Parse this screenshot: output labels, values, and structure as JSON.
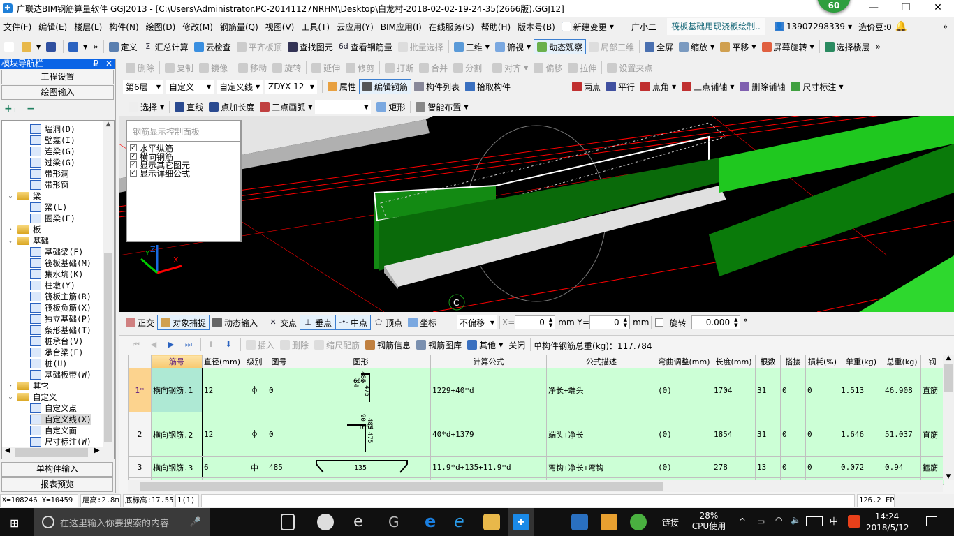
{
  "window": {
    "title": "广联达BIM钢筋算量软件 GGJ2013 - [C:\\Users\\Administrator.PC-20141127NRHM\\Desktop\\白龙村-2018-02-02-19-24-35(2666版).GGJ12]",
    "badge": "60",
    "minimize": "—",
    "restore": "❐",
    "close": "✕"
  },
  "menubar": {
    "items": [
      "文件(F)",
      "编辑(E)",
      "楼层(L)",
      "构件(N)",
      "绘图(D)",
      "修改(M)",
      "钢筋量(Q)",
      "视图(V)",
      "工具(T)",
      "云应用(Y)",
      "BIM应用(I)",
      "在线服务(S)",
      "帮助(H)",
      "版本号(B)"
    ],
    "new_change": "新建变更",
    "assistant": "广小二",
    "notice": "筏板基础用现浇板绘制..",
    "user": "13907298339",
    "beans": "造价豆:0",
    "more": "»"
  },
  "toolbar1": [
    {
      "label": "",
      "icon": "new-file",
      "c": "#fff"
    },
    {
      "label": "",
      "icon": "open-folder",
      "c": "#e8b84a",
      "dd": 1
    },
    {
      "label": "",
      "icon": "save",
      "c": "#3050a0"
    },
    {
      "sep": 1
    },
    {
      "label": "",
      "icon": "undo",
      "c": "#2a62c0",
      "dd": 1
    },
    {
      "label": "»",
      "icon": ""
    },
    {
      "sep": 1
    },
    {
      "label": "定义",
      "icon": "define",
      "c": "#5a7fb0"
    },
    {
      "label": "汇总计算",
      "icon": "sigma",
      "g": "Σ"
    },
    {
      "label": "云检查",
      "icon": "cloud-check",
      "c": "#3a8fe0"
    },
    {
      "label": "平齐板顶",
      "icon": "align-slab",
      "dis": 1,
      "c": "#ccc"
    },
    {
      "label": "查找图元",
      "icon": "binoculars",
      "c": "#335"
    },
    {
      "label": "查看钢筋量",
      "icon": "view-rebar",
      "g": "6d"
    },
    {
      "label": "批量选择",
      "icon": "batch-select",
      "dis": 1,
      "c": "#ddd"
    },
    {
      "sep": 1
    },
    {
      "label": "三维",
      "icon": "cube",
      "c": "#5a9ad8",
      "dd": 1
    },
    {
      "label": "俯视",
      "icon": "top-view",
      "c": "#7aa8e0",
      "dd": 1
    },
    {
      "label": "动态观察",
      "icon": "orbit",
      "c": "#6ab04c",
      "act": 1
    },
    {
      "label": "局部三维",
      "icon": "local-3d",
      "dis": 1,
      "c": "#ddd"
    },
    {
      "sep": 1
    },
    {
      "label": "全屏",
      "icon": "fullscreen",
      "c": "#4a70b0"
    },
    {
      "label": "缩放",
      "icon": "zoom",
      "c": "#7a9ac0",
      "dd": 1
    },
    {
      "label": "平移",
      "icon": "pan",
      "c": "#d0a050",
      "dd": 1
    },
    {
      "label": "屏幕旋转",
      "icon": "screen-rotate",
      "c": "#e06040",
      "dd": 1
    },
    {
      "sep": 1
    },
    {
      "label": "选择楼层",
      "icon": "select-floor",
      "c": "#2a8a60"
    },
    {
      "label": "»",
      "icon": ""
    }
  ],
  "toolbar2": [
    {
      "label": "删除",
      "icon": "delete",
      "dis": 1,
      "c": "#ccc"
    },
    {
      "sep": 1
    },
    {
      "label": "复制",
      "icon": "copy",
      "dis": 1,
      "c": "#ccc"
    },
    {
      "label": "镜像",
      "icon": "mirror",
      "dis": 1,
      "c": "#ccc"
    },
    {
      "sep": 1
    },
    {
      "label": "移动",
      "icon": "move",
      "dis": 1,
      "c": "#ccc"
    },
    {
      "label": "旋转",
      "icon": "rotate",
      "dis": 1,
      "c": "#ccc"
    },
    {
      "sep": 1
    },
    {
      "label": "延伸",
      "icon": "extend",
      "dis": 1,
      "c": "#ccc"
    },
    {
      "label": "修剪",
      "icon": "trim",
      "dis": 1,
      "c": "#ccc"
    },
    {
      "sep": 1
    },
    {
      "label": "打断",
      "icon": "break",
      "dis": 1,
      "c": "#ccc"
    },
    {
      "label": "合并",
      "icon": "merge",
      "dis": 1,
      "c": "#ccc"
    },
    {
      "label": "分割",
      "icon": "split",
      "dis": 1,
      "c": "#ccc"
    },
    {
      "sep": 1
    },
    {
      "label": "对齐",
      "icon": "align",
      "dis": 1,
      "c": "#ccc",
      "dd": 1
    },
    {
      "label": "偏移",
      "icon": "offset",
      "dis": 1,
      "c": "#ccc"
    },
    {
      "label": "拉伸",
      "icon": "stretch",
      "dis": 1,
      "c": "#ccc"
    },
    {
      "sep": 1
    },
    {
      "label": "设置夹点",
      "icon": "grip",
      "dis": 1,
      "c": "#ccc"
    }
  ],
  "toolbar3": {
    "combos": [
      "第6层",
      "自定义",
      "自定义线",
      "ZDYX-12"
    ],
    "items": [
      {
        "label": "属性",
        "icon": "properties",
        "c": "#e8a040"
      },
      {
        "label": "编辑钢筋",
        "icon": "edit-rebar",
        "c": "#555",
        "act": 1
      },
      {
        "label": "构件列表",
        "icon": "component-list",
        "c": "#889"
      },
      {
        "label": "拾取构件",
        "icon": "pick-component",
        "c": "#3a70c0"
      }
    ],
    "axis": [
      {
        "label": "两点",
        "icon": "two-point-axis",
        "c": "#c03030"
      },
      {
        "label": "平行",
        "icon": "parallel-axis",
        "c": "#4050a0"
      },
      {
        "label": "点角",
        "icon": "point-angle-axis",
        "c": "#c03030",
        "dd": 1
      },
      {
        "label": "三点辅轴",
        "icon": "three-point-axis",
        "c": "#c03030",
        "dd": 1
      },
      {
        "label": "删除辅轴",
        "icon": "delete-axis",
        "c": "#8060b0"
      },
      {
        "label": "尺寸标注",
        "icon": "dimension",
        "c": "#40a040",
        "dd": 1
      }
    ]
  },
  "toolbar4": [
    {
      "label": "选择",
      "icon": "cursor",
      "c": "#eee",
      "dd": 1
    },
    {
      "sep": 1
    },
    {
      "label": "直线",
      "icon": "line",
      "c": "#2a4a90"
    },
    {
      "label": "点加长度",
      "icon": "point-length",
      "c": "#2a4a90"
    },
    {
      "label": "三点画弧",
      "icon": "arc",
      "c": "#c04040",
      "dd": 1
    },
    {
      "combo": ""
    },
    {
      "label": "矩形",
      "icon": "rectangle",
      "c": "#7aa8e0"
    },
    {
      "sep": 1
    },
    {
      "label": "智能布置",
      "icon": "smart-layout",
      "c": "#888",
      "dd": 1
    }
  ],
  "nav": {
    "title": "模块导航栏",
    "pin": "₽",
    "close": "✕",
    "project_settings": "工程设置",
    "drawing_input": "绘图输入",
    "expand_all": "+₊",
    "collapse_all": "−",
    "single_input": "单构件输入",
    "report_preview": "报表预览"
  },
  "tree": [
    {
      "label": "墙洞(D)",
      "lv": 2
    },
    {
      "label": "壁龛(I)",
      "lv": 2
    },
    {
      "label": "连梁(G)",
      "lv": 2
    },
    {
      "label": "过梁(G)",
      "lv": 2
    },
    {
      "label": "带形洞",
      "lv": 2
    },
    {
      "label": "带形窗",
      "lv": 2
    },
    {
      "label": "梁",
      "lv": 1,
      "exp": "open"
    },
    {
      "label": "梁(L)",
      "lv": 2
    },
    {
      "label": "圈梁(E)",
      "lv": 2
    },
    {
      "label": "板",
      "lv": 1,
      "exp": "closed"
    },
    {
      "label": "基础",
      "lv": 1,
      "exp": "open"
    },
    {
      "label": "基础梁(F)",
      "lv": 2
    },
    {
      "label": "筏板基础(M)",
      "lv": 2
    },
    {
      "label": "集水坑(K)",
      "lv": 2
    },
    {
      "label": "柱墩(Y)",
      "lv": 2
    },
    {
      "label": "筏板主筋(R)",
      "lv": 2
    },
    {
      "label": "筏板负筋(X)",
      "lv": 2
    },
    {
      "label": "独立基础(P)",
      "lv": 2
    },
    {
      "label": "条形基础(T)",
      "lv": 2
    },
    {
      "label": "桩承台(V)",
      "lv": 2
    },
    {
      "label": "承台梁(F)",
      "lv": 2
    },
    {
      "label": "桩(U)",
      "lv": 2
    },
    {
      "label": "基础板带(W)",
      "lv": 2
    },
    {
      "label": "其它",
      "lv": 1,
      "exp": "closed"
    },
    {
      "label": "自定义",
      "lv": 1,
      "exp": "open"
    },
    {
      "label": "自定义点",
      "lv": 2
    },
    {
      "label": "自定义线(X)",
      "lv": 2,
      "sel": 1
    },
    {
      "label": "自定义面",
      "lv": 2
    },
    {
      "label": "尺寸标注(W)",
      "lv": 2
    }
  ],
  "rebar_panel": {
    "title": "钢筋显示控制面板",
    "options": [
      {
        "label": "水平纵筋",
        "checked": true
      },
      {
        "label": "横向钢筋",
        "checked": true
      },
      {
        "label": "显示其它图元",
        "checked": true
      },
      {
        "label": "显示详细公式",
        "checked": true
      }
    ]
  },
  "viewport": {
    "axis_label": "C",
    "x": "X",
    "y": "Y",
    "z": "Z"
  },
  "snapbar": {
    "items": [
      {
        "label": "正交",
        "icon": "ortho",
        "c": "#d08080"
      },
      {
        "label": "对象捕捉",
        "icon": "object-snap",
        "c": "#d0a050",
        "act": 1
      },
      {
        "label": "动态输入",
        "icon": "dynamic-input",
        "c": "#666"
      },
      {
        "sep": 1
      },
      {
        "label": "交点",
        "icon": "intersection",
        "g": "✕"
      },
      {
        "label": "垂点",
        "icon": "perpendicular",
        "g": "⊥",
        "act": 1
      },
      {
        "label": "中点",
        "icon": "midpoint",
        "g": "-•-",
        "act": 1
      },
      {
        "label": "顶点",
        "icon": "vertex",
        "g": "⬠"
      },
      {
        "label": "坐标",
        "icon": "coordinate",
        "c": "#7aa8e0"
      }
    ],
    "offset": "不偏移",
    "x_label": "X=",
    "x_value": "0",
    "y_label": "Y=",
    "y_value": "0",
    "unit": "mm",
    "rotate_label": "旋转",
    "rotate_value": "0.000",
    "degree": "°"
  },
  "rebar_toolbar": {
    "items": [
      {
        "label": "",
        "icon": "first-record",
        "g": "⏮",
        "dis": 1
      },
      {
        "label": "",
        "icon": "prev-record",
        "g": "◀",
        "dis": 1
      },
      {
        "label": "",
        "icon": "next-record",
        "g": "▶",
        "blue": 1
      },
      {
        "label": "",
        "icon": "last-record",
        "g": "⏭",
        "blue": 1
      },
      {
        "sep": 1
      },
      {
        "label": "",
        "icon": "move-up",
        "g": "⬆",
        "dis": 1
      },
      {
        "label": "",
        "icon": "move-down",
        "g": "⬇",
        "blue": 1
      },
      {
        "sep": 1
      },
      {
        "label": "插入",
        "icon": "insert",
        "dis": 1,
        "c": "#ddd"
      },
      {
        "label": "删除",
        "icon": "delete-row",
        "dis": 1,
        "c": "#ddd"
      },
      {
        "label": "缩尺配筋",
        "icon": "scale-rebar",
        "dis": 1,
        "c": "#ddd"
      },
      {
        "label": "钢筋信息",
        "icon": "rebar-info",
        "c": "#c08040"
      },
      {
        "label": "钢筋图库",
        "icon": "rebar-library",
        "c": "#7a90b0"
      },
      {
        "label": "其他",
        "icon": "other",
        "c": "#3a70c0",
        "dd": 1
      },
      {
        "label": "关闭",
        "icon": ""
      },
      {
        "sep": 1
      }
    ],
    "total": "单构件钢筋总重(kg)：117.784"
  },
  "rebar_table": {
    "columns": [
      "",
      "筋号",
      "直径(mm)",
      "级别",
      "图号",
      "图形",
      "计算公式",
      "公式描述",
      "弯曲调整(mm)",
      "长度(mm)",
      "根数",
      "搭接",
      "损耗(%)",
      "单重(kg)",
      "总重(kg)",
      "钢"
    ],
    "rows": [
      {
        "no": "1*",
        "name": "横向钢筋.1",
        "dia": "12",
        "grade": "⌽",
        "fig": "0",
        "shape_labels": [
          "84",
          "485",
          "660",
          "475"
        ],
        "formula": "1229+40*d",
        "desc": "净长+端头",
        "bend": "(0)",
        "length": "1704",
        "count": "31",
        "lap": "0",
        "loss": "0",
        "unit_w": "1.513",
        "total_w": "46.908",
        "type": "直筋"
      },
      {
        "no": "2",
        "name": "横向钢筋.2",
        "dia": "12",
        "grade": "⌽",
        "fig": "0",
        "shape_labels": [
          "90",
          "485",
          "1654",
          "475"
        ],
        "formula": "40*d+1379",
        "desc": "端头+净长",
        "bend": "(0)",
        "length": "1854",
        "count": "31",
        "lap": "0",
        "loss": "0",
        "unit_w": "1.646",
        "total_w": "51.037",
        "type": "直筋"
      },
      {
        "no": "3",
        "name": "横向钢筋.3",
        "dia": "6",
        "grade": "中",
        "fig": "485",
        "shape_labels": [
          "135"
        ],
        "formula": "11.9*d+135+11.9*d",
        "desc": "弯钩+净长+弯钩",
        "bend": "(0)",
        "length": "278",
        "count": "13",
        "lap": "0",
        "loss": "0",
        "unit_w": "0.072",
        "total_w": "0.94",
        "type": "箍筋"
      }
    ]
  },
  "statusbar": {
    "coords": "X=108246 Y=10459",
    "floor_height": "层高:2.8m",
    "base_elev": "底标高:17.55m",
    "count": "1(1)",
    "fps": "126.2 FPS"
  },
  "taskbar": {
    "search_placeholder": "在这里输入你要搜索的内容",
    "link": "链接",
    "cpu_pct": "28%",
    "cpu_label": "CPU使用",
    "ime": "中",
    "time": "14:24",
    "date": "2018/5/12"
  }
}
